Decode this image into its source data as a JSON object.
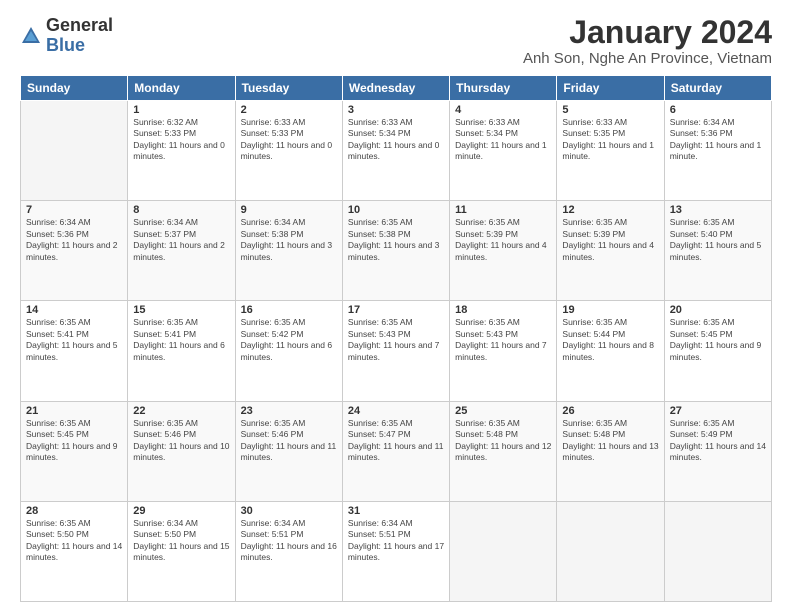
{
  "logo": {
    "general": "General",
    "blue": "Blue"
  },
  "title": "January 2024",
  "subtitle": "Anh Son, Nghe An Province, Vietnam",
  "days_of_week": [
    "Sunday",
    "Monday",
    "Tuesday",
    "Wednesday",
    "Thursday",
    "Friday",
    "Saturday"
  ],
  "weeks": [
    [
      {
        "day": null
      },
      {
        "day": 1,
        "sunrise": "6:32 AM",
        "sunset": "5:33 PM",
        "daylight": "11 hours and 0 minutes."
      },
      {
        "day": 2,
        "sunrise": "6:33 AM",
        "sunset": "5:33 PM",
        "daylight": "11 hours and 0 minutes."
      },
      {
        "day": 3,
        "sunrise": "6:33 AM",
        "sunset": "5:34 PM",
        "daylight": "11 hours and 0 minutes."
      },
      {
        "day": 4,
        "sunrise": "6:33 AM",
        "sunset": "5:34 PM",
        "daylight": "11 hours and 1 minute."
      },
      {
        "day": 5,
        "sunrise": "6:33 AM",
        "sunset": "5:35 PM",
        "daylight": "11 hours and 1 minute."
      },
      {
        "day": 6,
        "sunrise": "6:34 AM",
        "sunset": "5:36 PM",
        "daylight": "11 hours and 1 minute."
      }
    ],
    [
      {
        "day": 7,
        "sunrise": "6:34 AM",
        "sunset": "5:36 PM",
        "daylight": "11 hours and 2 minutes."
      },
      {
        "day": 8,
        "sunrise": "6:34 AM",
        "sunset": "5:37 PM",
        "daylight": "11 hours and 2 minutes."
      },
      {
        "day": 9,
        "sunrise": "6:34 AM",
        "sunset": "5:38 PM",
        "daylight": "11 hours and 3 minutes."
      },
      {
        "day": 10,
        "sunrise": "6:35 AM",
        "sunset": "5:38 PM",
        "daylight": "11 hours and 3 minutes."
      },
      {
        "day": 11,
        "sunrise": "6:35 AM",
        "sunset": "5:39 PM",
        "daylight": "11 hours and 4 minutes."
      },
      {
        "day": 12,
        "sunrise": "6:35 AM",
        "sunset": "5:39 PM",
        "daylight": "11 hours and 4 minutes."
      },
      {
        "day": 13,
        "sunrise": "6:35 AM",
        "sunset": "5:40 PM",
        "daylight": "11 hours and 5 minutes."
      }
    ],
    [
      {
        "day": 14,
        "sunrise": "6:35 AM",
        "sunset": "5:41 PM",
        "daylight": "11 hours and 5 minutes."
      },
      {
        "day": 15,
        "sunrise": "6:35 AM",
        "sunset": "5:41 PM",
        "daylight": "11 hours and 6 minutes."
      },
      {
        "day": 16,
        "sunrise": "6:35 AM",
        "sunset": "5:42 PM",
        "daylight": "11 hours and 6 minutes."
      },
      {
        "day": 17,
        "sunrise": "6:35 AM",
        "sunset": "5:43 PM",
        "daylight": "11 hours and 7 minutes."
      },
      {
        "day": 18,
        "sunrise": "6:35 AM",
        "sunset": "5:43 PM",
        "daylight": "11 hours and 7 minutes."
      },
      {
        "day": 19,
        "sunrise": "6:35 AM",
        "sunset": "5:44 PM",
        "daylight": "11 hours and 8 minutes."
      },
      {
        "day": 20,
        "sunrise": "6:35 AM",
        "sunset": "5:45 PM",
        "daylight": "11 hours and 9 minutes."
      }
    ],
    [
      {
        "day": 21,
        "sunrise": "6:35 AM",
        "sunset": "5:45 PM",
        "daylight": "11 hours and 9 minutes."
      },
      {
        "day": 22,
        "sunrise": "6:35 AM",
        "sunset": "5:46 PM",
        "daylight": "11 hours and 10 minutes."
      },
      {
        "day": 23,
        "sunrise": "6:35 AM",
        "sunset": "5:46 PM",
        "daylight": "11 hours and 11 minutes."
      },
      {
        "day": 24,
        "sunrise": "6:35 AM",
        "sunset": "5:47 PM",
        "daylight": "11 hours and 11 minutes."
      },
      {
        "day": 25,
        "sunrise": "6:35 AM",
        "sunset": "5:48 PM",
        "daylight": "11 hours and 12 minutes."
      },
      {
        "day": 26,
        "sunrise": "6:35 AM",
        "sunset": "5:48 PM",
        "daylight": "11 hours and 13 minutes."
      },
      {
        "day": 27,
        "sunrise": "6:35 AM",
        "sunset": "5:49 PM",
        "daylight": "11 hours and 14 minutes."
      }
    ],
    [
      {
        "day": 28,
        "sunrise": "6:35 AM",
        "sunset": "5:50 PM",
        "daylight": "11 hours and 14 minutes."
      },
      {
        "day": 29,
        "sunrise": "6:34 AM",
        "sunset": "5:50 PM",
        "daylight": "11 hours and 15 minutes."
      },
      {
        "day": 30,
        "sunrise": "6:34 AM",
        "sunset": "5:51 PM",
        "daylight": "11 hours and 16 minutes."
      },
      {
        "day": 31,
        "sunrise": "6:34 AM",
        "sunset": "5:51 PM",
        "daylight": "11 hours and 17 minutes."
      },
      {
        "day": null
      },
      {
        "day": null
      },
      {
        "day": null
      }
    ]
  ]
}
